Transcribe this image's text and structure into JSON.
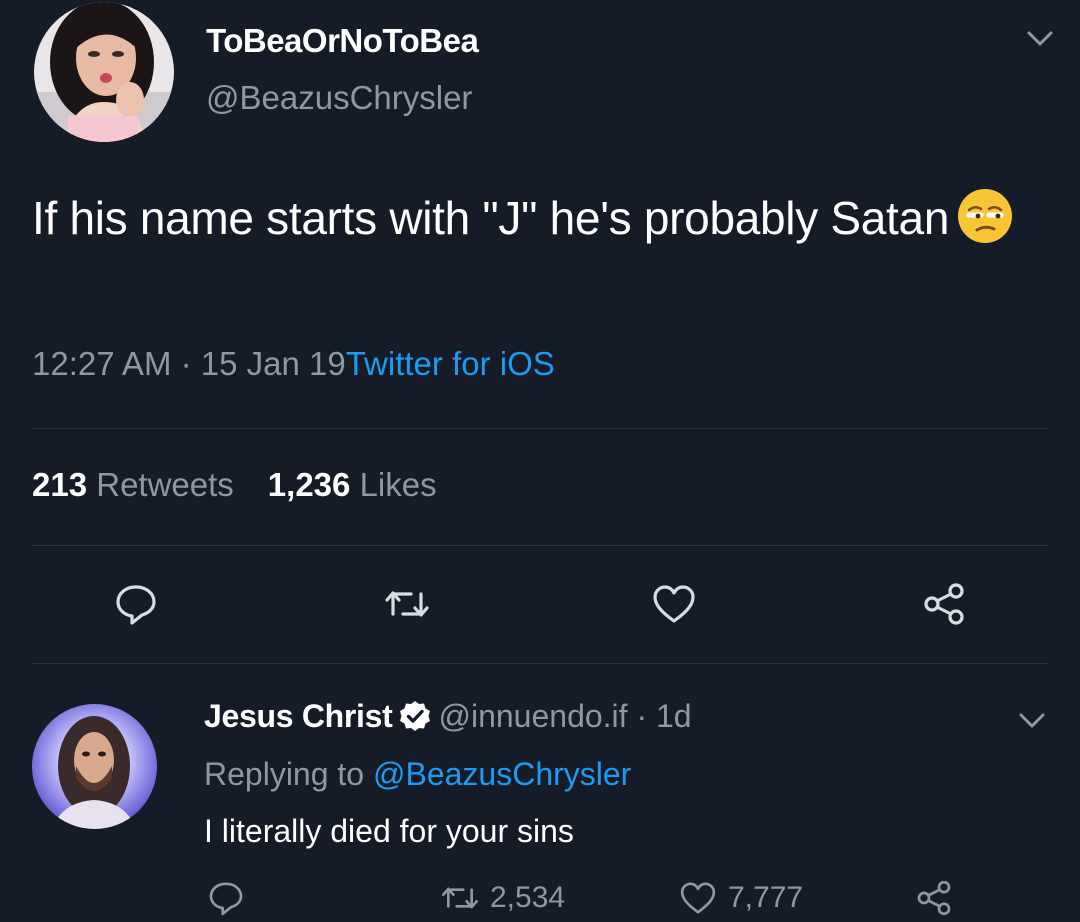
{
  "tweet": {
    "display_name": "ToBeaOrNoToBea",
    "handle": "@BeazusChrysler",
    "text": "If his name starts with \"J\" he's probably Satan",
    "emoji": "unamused-face",
    "time": "12:27 AM · 15 Jan 19",
    "source": "Twitter for iOS",
    "retweets_count": "213",
    "retweets_label": "Retweets",
    "likes_count": "1,236",
    "likes_label": "Likes",
    "actions": [
      "reply-icon",
      "retweet-icon",
      "heart-icon",
      "share-icon"
    ]
  },
  "reply": {
    "display_name": "Jesus Christ",
    "verified": true,
    "handle": "@innuendo.if",
    "age": "· 1d",
    "replying_prefix": "Replying to",
    "replying_to": "@BeazusChrysler",
    "text": "I literally died for your sins",
    "retweets": "2,534",
    "likes": "7,777"
  },
  "colors": {
    "background": "#161c27",
    "secondary_text": "#8b98a5",
    "link": "#1d9bf0",
    "divider": "#2a3342"
  }
}
